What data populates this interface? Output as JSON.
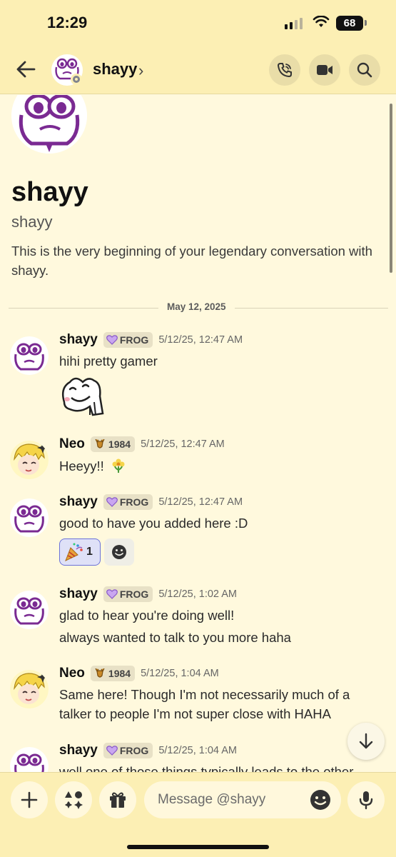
{
  "status_bar": {
    "time": "12:29",
    "battery": "68"
  },
  "header": {
    "name": "shayy",
    "chevron": "›"
  },
  "intro": {
    "display_name": "shayy",
    "username": "shayy",
    "text": "This is the very beginning of your legendary conversation with shayy."
  },
  "date_divider": "May 12, 2025",
  "messages": [
    {
      "author": "shayy",
      "tag": "FROG",
      "time": "5/12/25, 12:47 AM",
      "lines": [
        "hihi pretty gamer"
      ]
    },
    {
      "author": "Neo",
      "tag": "1984",
      "time": "5/12/25, 12:47 AM",
      "lines": [
        "Heeyy!!"
      ]
    },
    {
      "author": "shayy",
      "tag": "FROG",
      "time": "5/12/25, 12:47 AM",
      "lines": [
        "good to have you added here :D"
      ],
      "reaction_count": "1"
    },
    {
      "author": "shayy",
      "tag": "FROG",
      "time": "5/12/25, 1:02 AM",
      "lines": [
        "glad to hear you're doing well!",
        "always wanted to talk to you more haha"
      ]
    },
    {
      "author": "Neo",
      "tag": "1984",
      "time": "5/12/25, 1:04 AM",
      "lines": [
        "Same here! Though I'm not necessarily much of a",
        "talker to people I'm not super close with HAHA"
      ]
    },
    {
      "author": "shayy",
      "tag": "FROG",
      "time": "5/12/25, 1:04 AM",
      "lines": [
        "well one of those things typically leads to the other"
      ]
    }
  ],
  "composer": {
    "placeholder": "Message @shayy"
  },
  "icons": [
    "back-arrow-icon",
    "phone-icon",
    "video-icon",
    "search-icon",
    "plus-icon",
    "apps-icon",
    "gift-icon",
    "emoji-icon",
    "microphone-icon",
    "arrow-down-icon",
    "party-popper-icon",
    "flower-icon"
  ],
  "colors": {
    "header_bg": "#fcefb4",
    "chat_bg": "#fff9dd",
    "reaction_border": "#6c73d9"
  }
}
